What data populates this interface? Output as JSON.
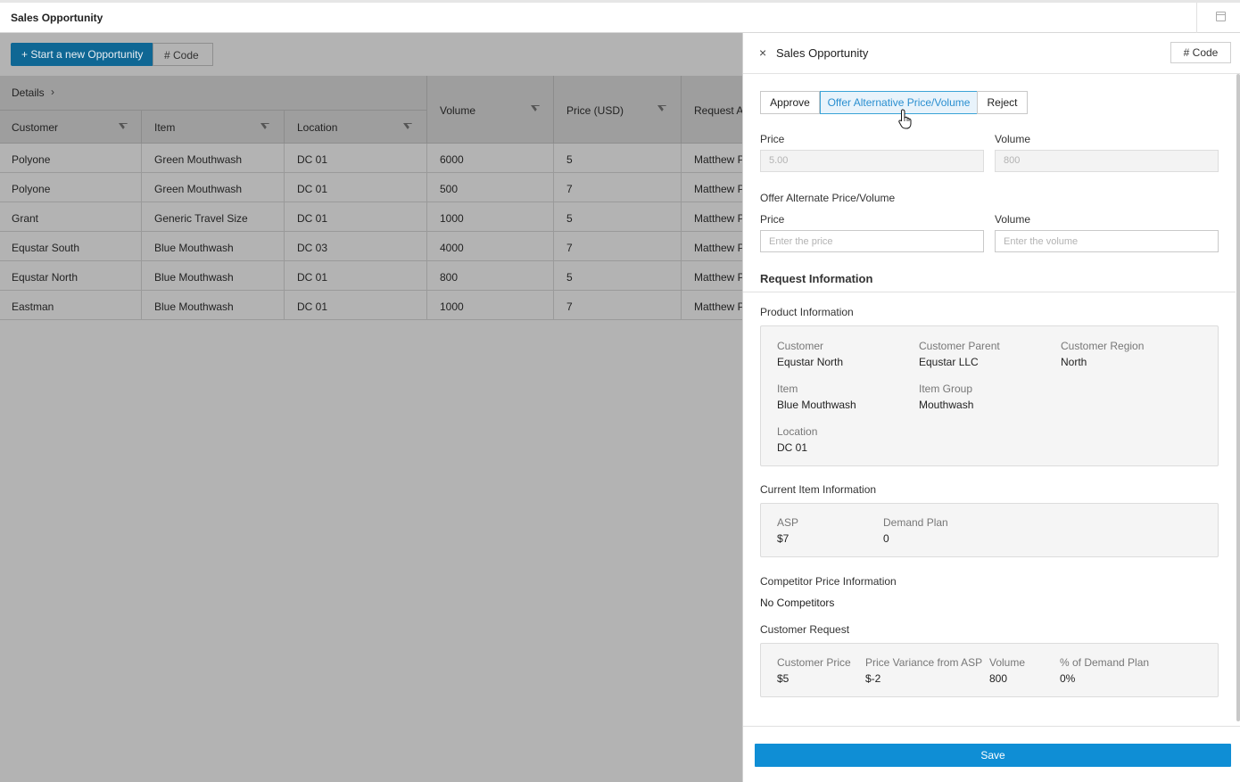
{
  "topbar": {
    "title": "Sales Opportunity"
  },
  "toolbar": {
    "new_label": "+ Start a new Opportunity",
    "code_label": "# Code"
  },
  "grid": {
    "details_label": "Details",
    "columns": [
      "Customer",
      "Item",
      "Location",
      "Volume",
      "Price (USD)",
      "Request Au"
    ],
    "rows": [
      [
        "Polyone",
        "Green Mouthwash",
        "DC 01",
        "6000",
        "5",
        "Matthew P"
      ],
      [
        "Polyone",
        "Green Mouthwash",
        "DC 01",
        "500",
        "7",
        "Matthew P"
      ],
      [
        "Grant",
        "Generic Travel Size",
        "DC 01",
        "1000",
        "5",
        "Matthew P"
      ],
      [
        "Equstar South",
        "Blue Mouthwash",
        "DC 03",
        "4000",
        "7",
        "Matthew P"
      ],
      [
        "Equstar North",
        "Blue Mouthwash",
        "DC 01",
        "800",
        "5",
        "Matthew P"
      ],
      [
        "Eastman",
        "Blue Mouthwash",
        "DC 01",
        "1000",
        "7",
        "Matthew P"
      ]
    ]
  },
  "panel": {
    "title": "Sales Opportunity",
    "code_label": "Code",
    "actions": {
      "approve": "Approve",
      "offer": "Offer Alternative Price/Volume",
      "reject": "Reject"
    },
    "current": {
      "price_label": "Price",
      "price_value": "5.00",
      "volume_label": "Volume",
      "volume_value": "800"
    },
    "offer": {
      "heading": "Offer Alternate Price/Volume",
      "price_label": "Price",
      "price_placeholder": "Enter the price",
      "volume_label": "Volume",
      "volume_placeholder": "Enter the volume"
    },
    "request_info_title": "Request Information",
    "product_info": {
      "title": "Product Information",
      "customer_k": "Customer",
      "customer_v": "Equstar North",
      "parent_k": "Customer Parent",
      "parent_v": "Equstar LLC",
      "region_k": "Customer Region",
      "region_v": "North",
      "item_k": "Item",
      "item_v": "Blue Mouthwash",
      "group_k": "Item Group",
      "group_v": "Mouthwash",
      "location_k": "Location",
      "location_v": "DC 01"
    },
    "current_item": {
      "title": "Current Item Information",
      "asp_k": "ASP",
      "asp_v": "$7",
      "demand_k": "Demand Plan",
      "demand_v": "0"
    },
    "competitor": {
      "title": "Competitor Price Information",
      "text": "No Competitors"
    },
    "customer_request": {
      "title": "Customer Request",
      "price_k": "Customer Price",
      "price_v": "$5",
      "variance_k": "Price Variance from ASP",
      "variance_v": "$-2",
      "volume_k": "Volume",
      "volume_v": "800",
      "pct_k": "% of Demand Plan",
      "pct_v": "0%"
    },
    "save_label": "Save"
  }
}
